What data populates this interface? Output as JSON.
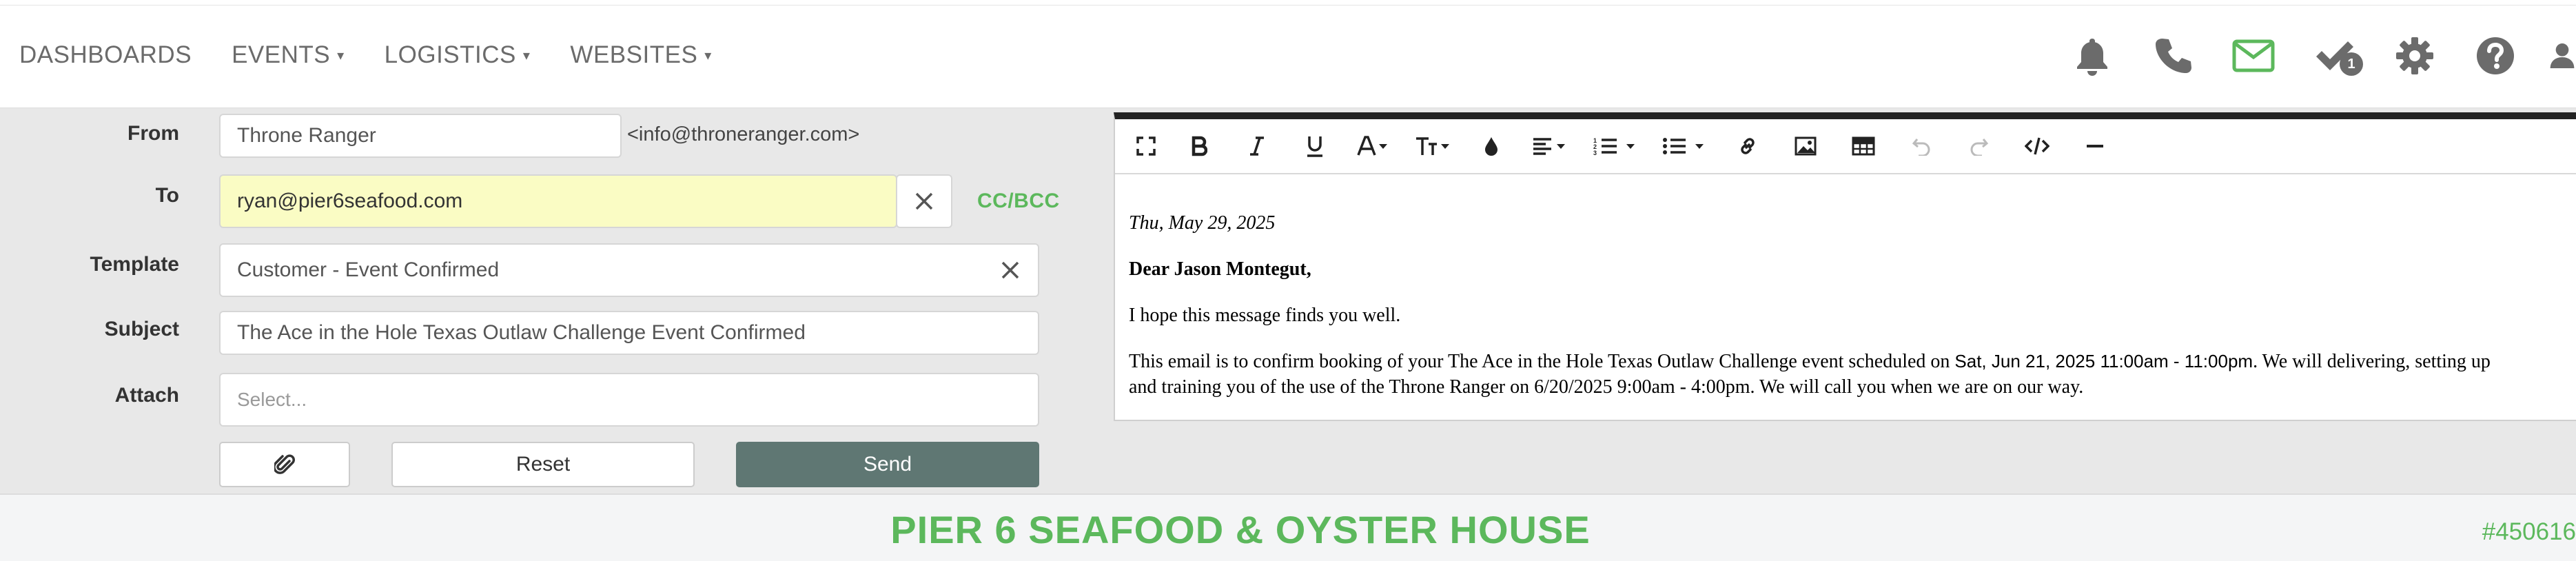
{
  "nav": {
    "items": [
      {
        "label": "DASHBOARDS",
        "has_caret": false
      },
      {
        "label": "EVENTS",
        "has_caret": true
      },
      {
        "label": "LOGISTICS",
        "has_caret": true
      },
      {
        "label": "WEBSITES",
        "has_caret": true
      }
    ],
    "caret": "▾",
    "icons": [
      "bell-icon",
      "phone-icon",
      "mail-icon",
      "check-icon",
      "gear-icon",
      "help-icon",
      "user-icon"
    ],
    "tasks_badge": "1",
    "active_icon_color": "#5cb85c"
  },
  "form": {
    "from_label": "From",
    "from_value": "Throne Ranger",
    "from_email": "<info@throneranger.com>",
    "to_label": "To",
    "to_value": "ryan@pier6seafood.com",
    "cc_bcc": "CC/BCC",
    "template_label": "Template",
    "template_value": "Customer - Event Confirmed",
    "subject_label": "Subject",
    "subject_value": "The Ace in the Hole Texas Outlaw Challenge Event Confirmed",
    "attach_label": "Attach",
    "attach_placeholder": "Select...",
    "reset_label": "Reset",
    "send_label": "Send"
  },
  "editor": {
    "date": "Thu, May 29, 2025",
    "greeting": "Dear Jason Montegut,",
    "line1": "I hope this message finds you well.",
    "line2_a": "This email is to confirm booking of your The Ace in the Hole Texas Outlaw Challenge event scheduled on ",
    "line2_date": "Sat, Jun 21, 2025 11:00am - 11:00pm",
    "line2_b": ". We will delivering, setting up",
    "line3": "and training you of the use of the Throne Ranger on 6/20/2025 9:00am - 4:00pm. We will call you when we are on our way."
  },
  "footer": {
    "venue": "PIER 6 SEAFOOD & OYSTER HOUSE",
    "event_number": "#450616"
  },
  "colors": {
    "accent_green": "#5cb85c",
    "send_button": "#5f7773",
    "to_field_highlight": "#fafcc4",
    "panel_gray": "#e8e8e8"
  }
}
